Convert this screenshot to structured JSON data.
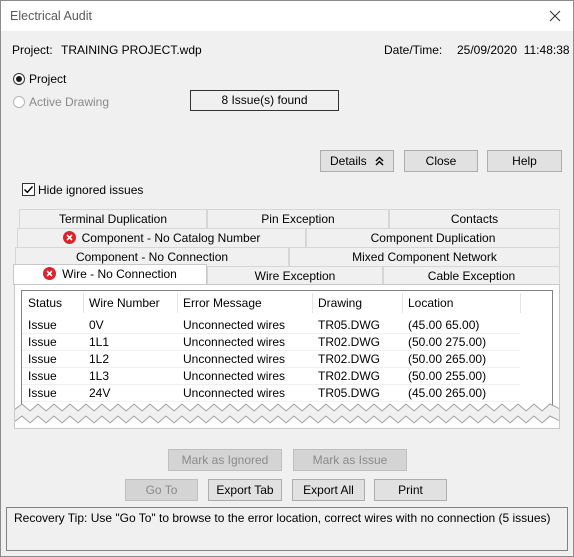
{
  "window": {
    "title": "Electrical Audit"
  },
  "header": {
    "project_label": "Project:",
    "project_value": "TRAINING PROJECT.wdp",
    "datetime_label": "Date/Time:",
    "datetime_value": "25/09/2020  11:48:38"
  },
  "scope": {
    "project_radio": "Project",
    "active_drawing_radio": "Active Drawing",
    "issues_found": "8 Issue(s) found"
  },
  "actions": {
    "details": "Details",
    "close": "Close",
    "help": "Help"
  },
  "hide_ignored": {
    "label": "Hide ignored issues",
    "checked": true
  },
  "tabs": {
    "row1": [
      "Terminal Duplication",
      "Pin Exception",
      "Contacts"
    ],
    "row2": [
      "Component - No Catalog Number",
      "Component Duplication"
    ],
    "row3": [
      "Component - No Connection",
      "Mixed Component Network"
    ],
    "row4": [
      "Wire - No Connection",
      "Wire Exception",
      "Cable Exception"
    ]
  },
  "table": {
    "columns": [
      "Status",
      "Wire Number",
      "Error Message",
      "Drawing",
      "Location"
    ],
    "rows": [
      [
        "Issue",
        "0V",
        "Unconnected wires",
        "TR05.DWG",
        "(45.00 65.00)"
      ],
      [
        "Issue",
        "1L1",
        "Unconnected wires",
        "TR02.DWG",
        "(50.00 275.00)"
      ],
      [
        "Issue",
        "1L2",
        "Unconnected wires",
        "TR02.DWG",
        "(50.00 265.00)"
      ],
      [
        "Issue",
        "1L3",
        "Unconnected wires",
        "TR02.DWG",
        "(50.00 255.00)"
      ],
      [
        "Issue",
        "24V",
        "Unconnected wires",
        "TR05.DWG",
        "(45.00 265.00)"
      ]
    ]
  },
  "row_actions": {
    "mark_ignored": "Mark as Ignored",
    "mark_issue": "Mark as Issue"
  },
  "bottom_actions": {
    "goto": "Go To",
    "export_tab": "Export Tab",
    "export_all": "Export All",
    "print": "Print"
  },
  "recovery_tip": "Recovery Tip: Use \"Go To\" to browse to the error location, correct wires with no connection (5 issues)",
  "icons": {
    "close": "close-icon",
    "error": "error-icon",
    "chevron": "double-chevron-up-icon"
  },
  "colors": {
    "error_red": "#d9242b",
    "window_bg": "#f0f0f0"
  }
}
